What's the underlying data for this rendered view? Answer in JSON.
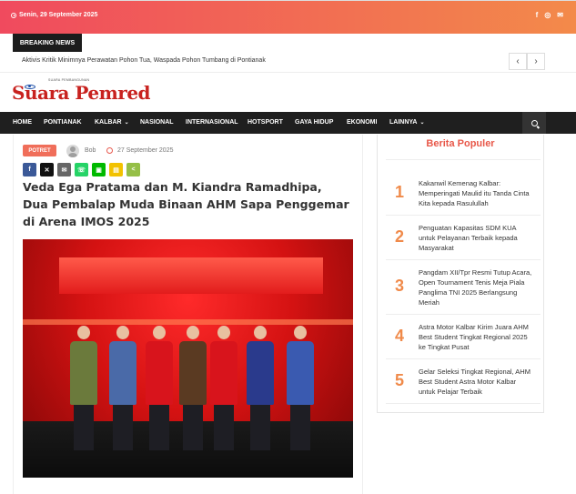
{
  "topbar": {
    "date": "Senin, 29 September 2025",
    "social": [
      {
        "icon": "facebook-icon",
        "glyph": "f"
      },
      {
        "icon": "instagram-icon",
        "glyph": "◎"
      },
      {
        "icon": "mail-icon",
        "glyph": "✉"
      }
    ]
  },
  "breaking": {
    "label": "BREAKING NEWS",
    "text": "Aktivis Kritik Minimnya Perawatan Pohon Tua, Waspada Pohon Tumbang di Pontianak",
    "prev": "‹",
    "next": "›"
  },
  "logo": {
    "tagline": "SUARA PEMBANGUNAN",
    "text": "Suara Pemred"
  },
  "nav": {
    "items": [
      {
        "label": "HOME"
      },
      {
        "label": "PONTIANAK"
      },
      {
        "label": "KALBAR",
        "caret": "⌄"
      },
      {
        "label": "NASIONAL"
      },
      {
        "label": "INTERNASIONAL"
      },
      {
        "label": "HOTSPORT"
      },
      {
        "label": "GAYA HIDUP"
      },
      {
        "label": "EKONOMI"
      },
      {
        "label": "LAINNYA",
        "caret": "⌄"
      }
    ]
  },
  "article": {
    "category": "POTRET",
    "author": "Bob",
    "date": "27 September 2025",
    "headline": "Veda Ega Pratama dan M. Kiandra Ramadhipa, Dua Pembalap Muda Binaan AHM Sapa Penggemar di Arena IMOS 2025",
    "share": [
      {
        "icon": "facebook-share-icon",
        "glyph": "f",
        "color": "#3b5998"
      },
      {
        "icon": "x-share-icon",
        "glyph": "✕",
        "color": "#111111"
      },
      {
        "icon": "email-share-icon",
        "glyph": "✉",
        "color": "#666666"
      },
      {
        "icon": "whatsapp-share-icon",
        "glyph": "☏",
        "color": "#25d366"
      },
      {
        "icon": "line-share-icon",
        "glyph": "▣",
        "color": "#00b900"
      },
      {
        "icon": "sms-share-icon",
        "glyph": "▤",
        "color": "#f2c200"
      },
      {
        "icon": "more-share-icon",
        "glyph": "<",
        "color": "#95bf47"
      }
    ]
  },
  "sidebar": {
    "title": "Berita Populer",
    "items": [
      {
        "num": "1",
        "text": "Kakanwil Kemenag Kalbar: Memperingati Maulid itu Tanda Cinta Kita kepada Rasulullah"
      },
      {
        "num": "2",
        "text": "Penguatan Kapasitas SDM KUA untuk Pelayanan Terbaik kepada Masyarakat"
      },
      {
        "num": "3",
        "text": "Pangdam XII/Tpr Resmi Tutup Acara, Open Tournament Tenis Meja Piala Panglima TNI 2025 Berlangsung Meriah"
      },
      {
        "num": "4",
        "text": "Astra Motor Kalbar Kirim Juara AHM Best Student Tingkat Regional 2025 ke Tingkat Pusat"
      },
      {
        "num": "5",
        "text": "Gelar Seleksi Tingkat Regional, AHM Best Student Astra Motor Kalbar untuk Pelajar Terbaik"
      }
    ]
  }
}
